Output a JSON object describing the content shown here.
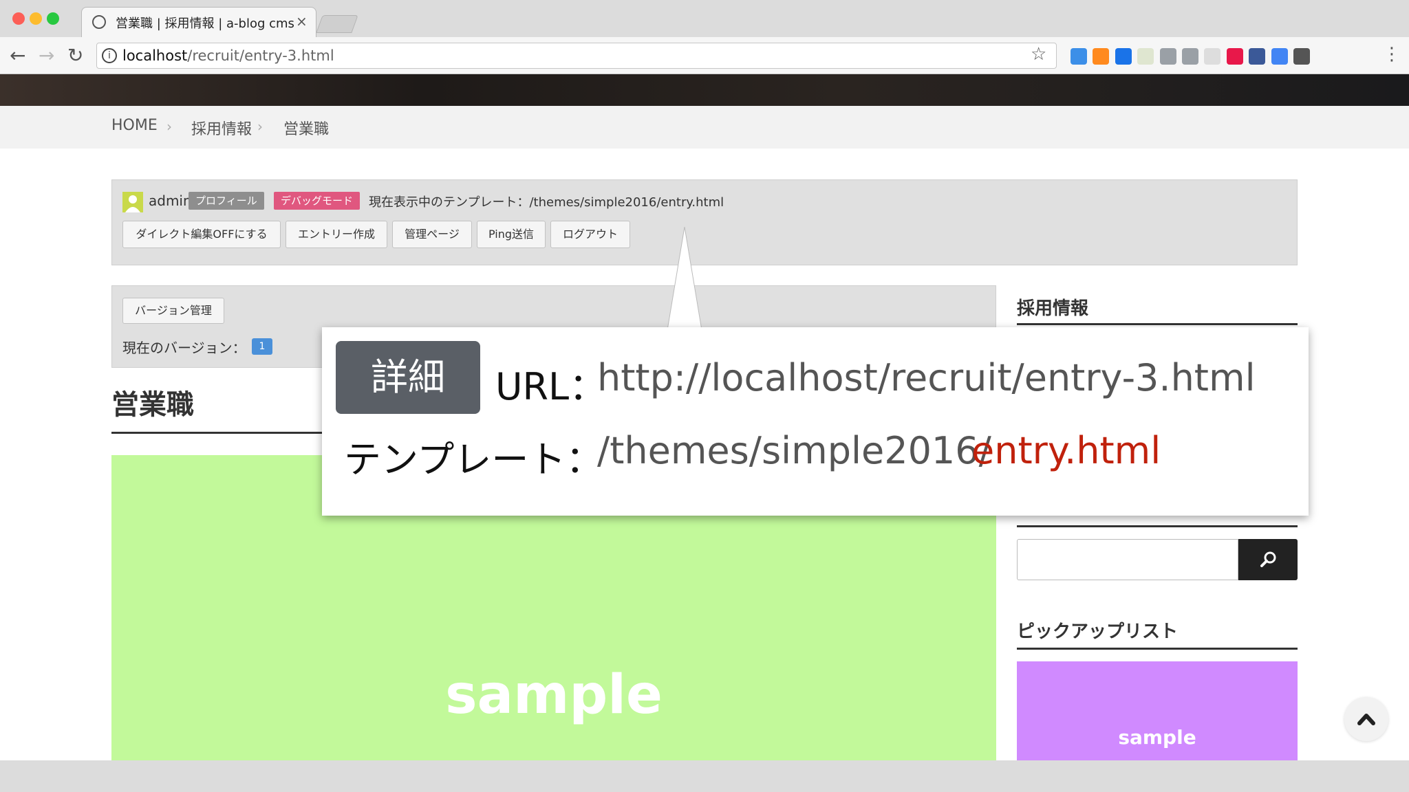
{
  "browser": {
    "tab_title": "営業職 | 採用情報 | a-blog cms",
    "tab_close": "×",
    "url_host": "localhost",
    "url_path": "/recruit/entry-3.html",
    "info_glyph": "i",
    "star_glyph": "☆",
    "menu_glyph": "⋮",
    "back_glyph": "←",
    "forward_glyph": "→",
    "reload_glyph": "↻",
    "extension_colors": [
      "#3c8fe8",
      "#ff8a1e",
      "#1a73e8",
      "#dfe6d0",
      "#9aa0a6",
      "#9aa0a6",
      "#dddddd",
      "#e8184a",
      "#3b5998",
      "#4285f4",
      "#555555"
    ]
  },
  "breadcrumb": {
    "items": [
      "HOME",
      "採用情報",
      "営業職"
    ],
    "separator": "›"
  },
  "admin": {
    "name": "admin",
    "profile_tag": "プロフィール",
    "debug_tag": "デバッグモード",
    "template_text": "現在表示中のテンプレート：/themes/simple2016/entry.html",
    "buttons": [
      "ダイレクト編集OFFにする",
      "エントリー作成",
      "管理ページ",
      "Ping送信",
      "ログアウト"
    ],
    "profile_color": "#8e8e8e",
    "debug_color": "#e0577f"
  },
  "version": {
    "button": "バージョン管理",
    "label": "現在のバージョン：",
    "number": "1"
  },
  "entry": {
    "title": "営業職",
    "image_label": "sample",
    "image_color": "#c2f99a"
  },
  "sidebar": {
    "heading_1": "採用情報",
    "heading_2": "ピックアップリスト",
    "pickup_label": "sample",
    "pickup_color": "#d08aff"
  },
  "callout": {
    "badge": "詳細",
    "url_label": "URL：",
    "url": "http://localhost/recruit/entry-3.html",
    "template_label": "テンプレート：",
    "template_path": "/themes/simple2016/",
    "template_file": "entry.html",
    "highlight_color": "#c0210c"
  }
}
